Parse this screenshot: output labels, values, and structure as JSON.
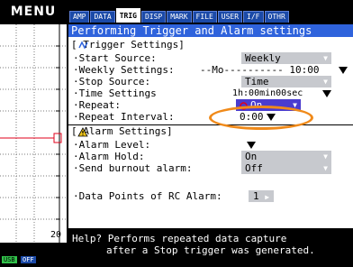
{
  "menu_label": "MENU",
  "tabs": [
    {
      "label": "AMP",
      "active": false
    },
    {
      "label": "DATA",
      "active": false
    },
    {
      "label": "TRIG",
      "active": true
    },
    {
      "label": "DISP",
      "active": false
    },
    {
      "label": "MARK",
      "active": false
    },
    {
      "label": "FILE",
      "active": false
    },
    {
      "label": "USER",
      "active": false
    },
    {
      "label": "I/F",
      "active": false
    },
    {
      "label": "OTHR",
      "active": false
    }
  ],
  "panel": {
    "title": "Performing Trigger and Alarm settings",
    "trigger_section": "[ Trigger Settings]",
    "start_source_label": "·Start Source:",
    "start_source_value": "Weekly",
    "weekly_label": "·Weekly Settings:",
    "weekly_value": "--Mo---------- 10:00",
    "stop_source_label": "·Stop Source:",
    "stop_source_value": "Time",
    "time_settings_label": "·Time Settings",
    "time_settings_value": "1h:00min00sec",
    "repeat_label": "·Repeat:",
    "repeat_value": "On",
    "repeat_interval_label": "·Repeat Interval:",
    "repeat_interval_value": "0:00",
    "alarm_section": "[ Alarm Settings]",
    "alarm_level_label": "·Alarm Level:",
    "alarm_hold_label": "·Alarm Hold:",
    "alarm_hold_value": "On",
    "burnout_label": "·Send burnout alarm:",
    "burnout_value": "Off",
    "rc_alarm_label": "·Data Points of RC Alarm:",
    "rc_alarm_value": "1"
  },
  "graph": {
    "value_label": "20"
  },
  "status": {
    "usb": "USB",
    "power": "OFF"
  },
  "help": {
    "line1": "Help? Performs repeated data capture",
    "line2": "after a Stop trigger was generated."
  },
  "colors": {
    "title_bar": "#2f63dc",
    "active_select": "#4a3ccf",
    "highlight_oval": "#f08a1a",
    "graph_trace": "#e0001b"
  }
}
